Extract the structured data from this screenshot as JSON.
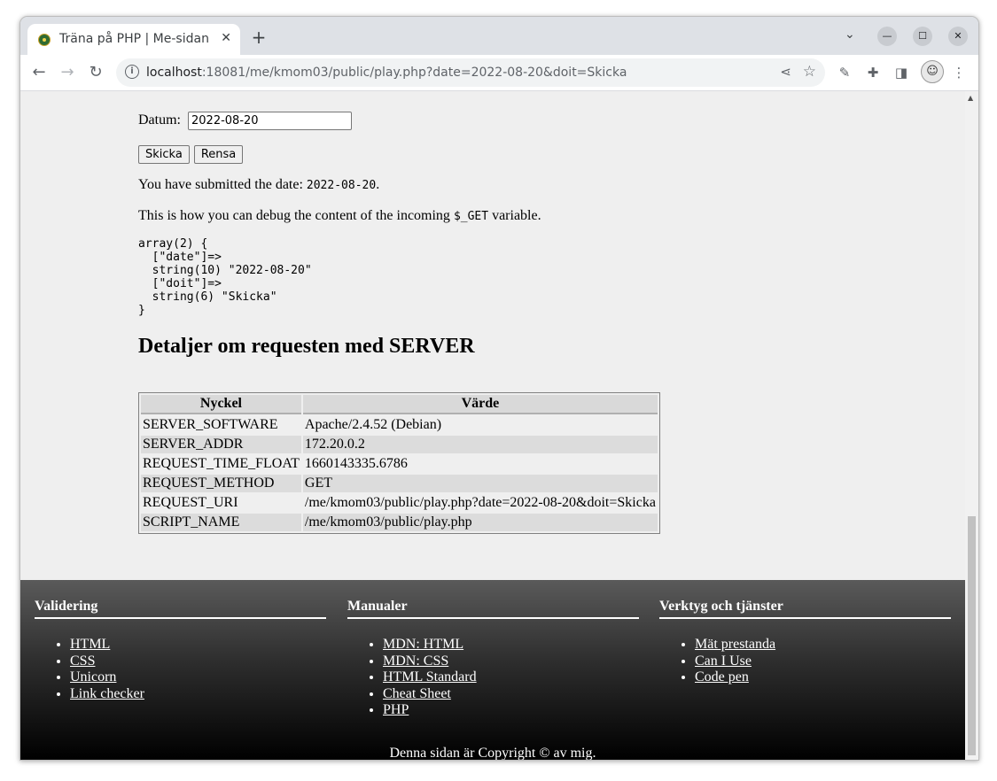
{
  "browser": {
    "tab_title": "Träna på PHP | Me-sidan",
    "url_host": "localhost",
    "url_rest": ":18081/me/kmom03/public/play.php?date=2022-08-20&doit=Skicka"
  },
  "form": {
    "date_label": "Datum:",
    "date_value": "2022-08-20",
    "submit_label": "Skicka",
    "reset_label": "Rensa"
  },
  "content": {
    "submitted_prefix": "You have submitted the date: ",
    "submitted_date": "2022-08-20",
    "submitted_suffix": ".",
    "debug_prefix": "This is how you can debug the content of the incoming ",
    "debug_var": "$_GET",
    "debug_suffix": " variable.",
    "dump": "array(2) {\n  [\"date\"]=>\n  string(10) \"2022-08-20\"\n  [\"doit\"]=>\n  string(6) \"Skicka\"\n}",
    "heading": "Detaljer om requesten med SERVER"
  },
  "server_table": {
    "headers": [
      "Nyckel",
      "Värde"
    ],
    "rows": [
      [
        "SERVER_SOFTWARE",
        "Apache/2.4.52 (Debian)"
      ],
      [
        "SERVER_ADDR",
        "172.20.0.2"
      ],
      [
        "REQUEST_TIME_FLOAT",
        "1660143335.6786"
      ],
      [
        "REQUEST_METHOD",
        "GET"
      ],
      [
        "REQUEST_URI",
        "/me/kmom03/public/play.php?date=2022-08-20&doit=Skicka"
      ],
      [
        "SCRIPT_NAME",
        "/me/kmom03/public/play.php"
      ]
    ]
  },
  "footer": {
    "columns": [
      {
        "title": "Validering",
        "links": [
          "HTML",
          "CSS",
          "Unicorn",
          "Link checker"
        ]
      },
      {
        "title": "Manualer",
        "links": [
          "MDN: HTML",
          "MDN: CSS",
          "HTML Standard",
          "Cheat Sheet",
          "PHP"
        ]
      },
      {
        "title": "Verktyg och tjänster",
        "links": [
          "Mät prestanda",
          "Can I Use",
          "Code pen"
        ]
      }
    ],
    "copyright": "Denna sidan är Copyright © av mig."
  },
  "icons": {
    "back": "arrow-left-icon",
    "forward": "arrow-right-icon",
    "reload": "reload-icon",
    "info": "info-icon",
    "share": "share-icon",
    "bookmark": "star-icon",
    "eyedropper": "eyedropper-icon",
    "extensions": "puzzle-icon",
    "sidepanel": "side-panel-icon",
    "menu": "kebab-menu-icon"
  }
}
